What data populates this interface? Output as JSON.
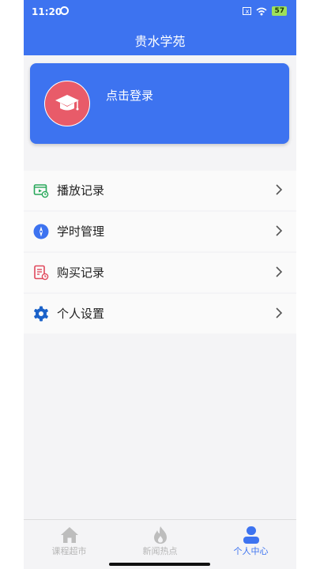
{
  "status": {
    "time": "11:20",
    "sim": "x",
    "battery": "57"
  },
  "header": {
    "title": "贵水学苑"
  },
  "login": {
    "label": "点击登录"
  },
  "menu": {
    "items": [
      {
        "label": "播放记录",
        "icon": "video-record-icon"
      },
      {
        "label": "学时管理",
        "icon": "compass-icon"
      },
      {
        "label": "购买记录",
        "icon": "receipt-icon"
      },
      {
        "label": "个人设置",
        "icon": "gear-icon"
      }
    ]
  },
  "tabs": [
    {
      "label": "课程超市",
      "icon": "home-icon",
      "active": false
    },
    {
      "label": "新闻热点",
      "icon": "flame-icon",
      "active": false
    },
    {
      "label": "个人中心",
      "icon": "person-icon",
      "active": true
    }
  ],
  "colors": {
    "brand": "#3d73f0",
    "avatar": "#e85b69",
    "inactive": "#b6b6b6"
  }
}
